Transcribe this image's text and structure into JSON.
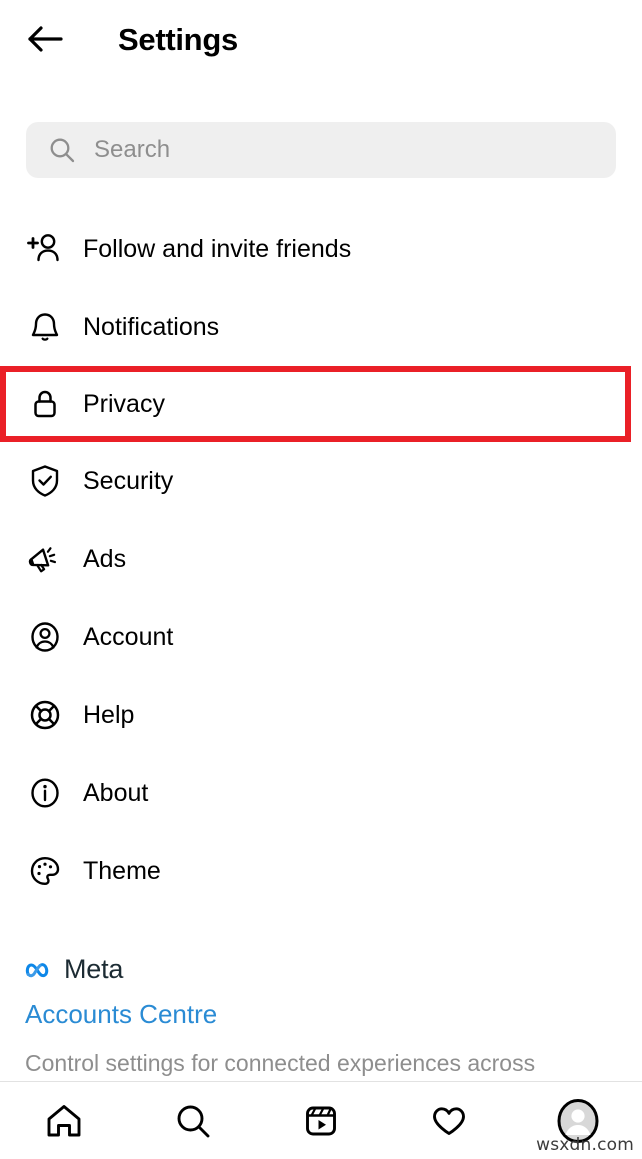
{
  "header": {
    "title": "Settings",
    "back_icon": "arrow-left-icon"
  },
  "search": {
    "placeholder": "Search",
    "value": "",
    "icon": "search-icon"
  },
  "menu": {
    "items": [
      {
        "label": "Follow and invite friends",
        "icon": "person-add-icon",
        "highlighted": false
      },
      {
        "label": "Notifications",
        "icon": "bell-icon",
        "highlighted": false
      },
      {
        "label": "Privacy",
        "icon": "lock-icon",
        "highlighted": true
      },
      {
        "label": "Security",
        "icon": "shield-check-icon",
        "highlighted": false
      },
      {
        "label": "Ads",
        "icon": "megaphone-icon",
        "highlighted": false
      },
      {
        "label": "Account",
        "icon": "account-circle-icon",
        "highlighted": false
      },
      {
        "label": "Help",
        "icon": "lifebuoy-icon",
        "highlighted": false
      },
      {
        "label": "About",
        "icon": "info-circle-icon",
        "highlighted": false
      },
      {
        "label": "Theme",
        "icon": "palette-icon",
        "highlighted": false
      }
    ]
  },
  "meta": {
    "brand": "Meta",
    "logo_icon": "meta-infinity-icon",
    "accounts_centre_link": "Accounts Centre",
    "description": "Control settings for connected experiences across"
  },
  "bottom_nav": {
    "items": [
      {
        "name": "home",
        "icon": "home-icon"
      },
      {
        "name": "search",
        "icon": "search-icon"
      },
      {
        "name": "reels",
        "icon": "reels-icon"
      },
      {
        "name": "activity",
        "icon": "heart-icon"
      },
      {
        "name": "profile",
        "icon": "avatar-icon"
      }
    ]
  },
  "watermark": "wsxdn.com",
  "colors": {
    "highlight_red": "#ea2027",
    "link_blue": "#2a8bd4",
    "meta_logo_blue": "#0d87e8",
    "search_bg": "#efefef",
    "muted_text": "#8e8e8e"
  }
}
